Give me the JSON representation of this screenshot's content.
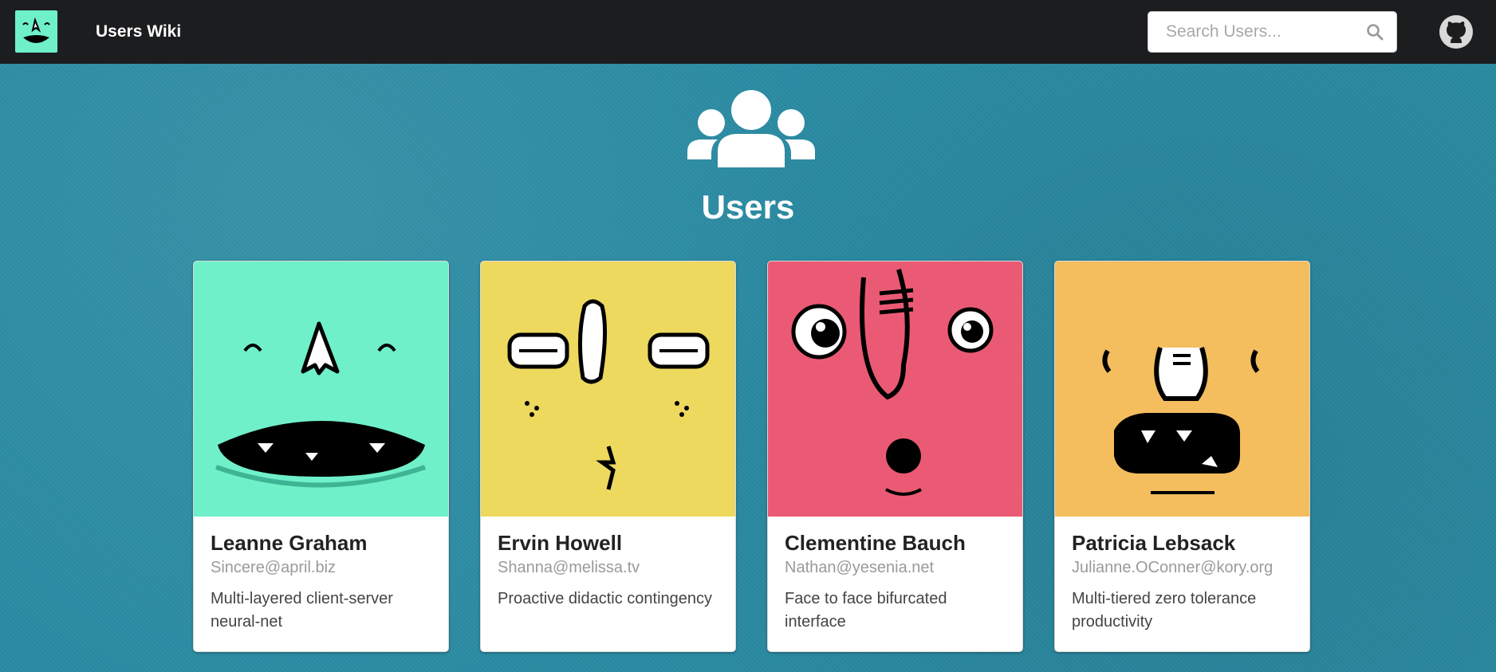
{
  "navbar": {
    "logo_icon": "monster-face-logo-icon",
    "title": "Users Wiki",
    "search": {
      "placeholder": "Search Users...",
      "value": "",
      "icon": "search-icon"
    },
    "github_icon": "github-icon"
  },
  "hero": {
    "icon": "users-group-icon",
    "title": "Users"
  },
  "users": [
    {
      "name": "Leanne Graham",
      "email": "Sincere@april.biz",
      "catchphrase": "Multi-layered client-server neural-net",
      "avatar_color": "#6ff0c9",
      "avatar_icon": "monster-face-grin-icon"
    },
    {
      "name": "Ervin Howell",
      "email": "Shanna@melissa.tv",
      "catchphrase": "Proactive didactic contingency",
      "avatar_color": "#ecd95e",
      "avatar_icon": "monster-face-sleepy-icon"
    },
    {
      "name": "Clementine Bauch",
      "email": "Nathan@yesenia.net",
      "catchphrase": "Face to face bifurcated interface",
      "avatar_color": "#eb5a74",
      "avatar_icon": "monster-face-surprised-icon"
    },
    {
      "name": "Patricia Lebsack",
      "email": "Julianne.OConner@kory.org",
      "catchphrase": "Multi-tiered zero tolerance productivity",
      "avatar_color": "#f4bd5e",
      "avatar_icon": "monster-face-shout-icon"
    }
  ]
}
